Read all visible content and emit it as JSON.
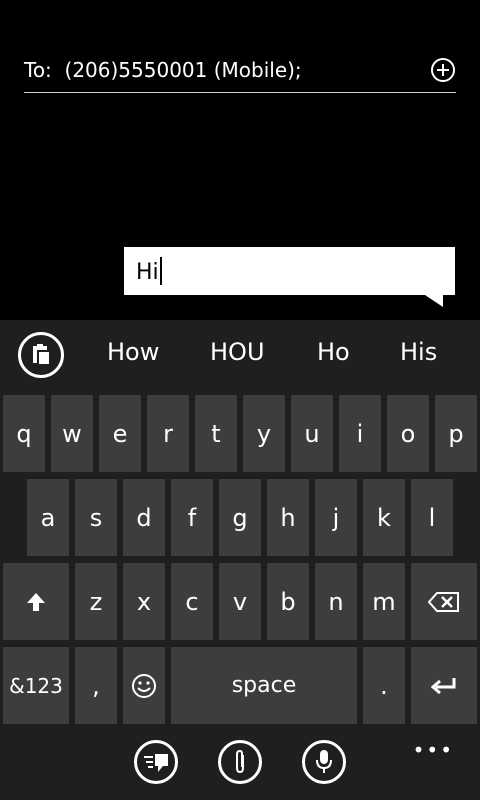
{
  "recipient": {
    "label": "To:",
    "value": "(206)5550001 (Mobile);"
  },
  "composer": {
    "text": "Hi"
  },
  "suggestions": [
    "How",
    "HOU",
    "Ho",
    "His"
  ],
  "keyboard": {
    "row1": [
      "q",
      "w",
      "e",
      "r",
      "t",
      "y",
      "u",
      "i",
      "o",
      "p"
    ],
    "row2": [
      "a",
      "s",
      "d",
      "f",
      "g",
      "h",
      "j",
      "k",
      "l"
    ],
    "row3": [
      "z",
      "x",
      "c",
      "v",
      "b",
      "n",
      "m"
    ],
    "numbers_label": "&123",
    "comma": ",",
    "space_label": "space",
    "period": "."
  },
  "more_label": "•••",
  "icons": {
    "add": "plus-circle-icon",
    "clipboard": "clipboard-icon",
    "shift": "shift-arrow-icon",
    "backspace": "backspace-icon",
    "emoji": "smiley-icon",
    "enter": "enter-icon",
    "quick_reply": "message-list-icon",
    "attach": "paperclip-icon",
    "voice": "microphone-icon"
  }
}
